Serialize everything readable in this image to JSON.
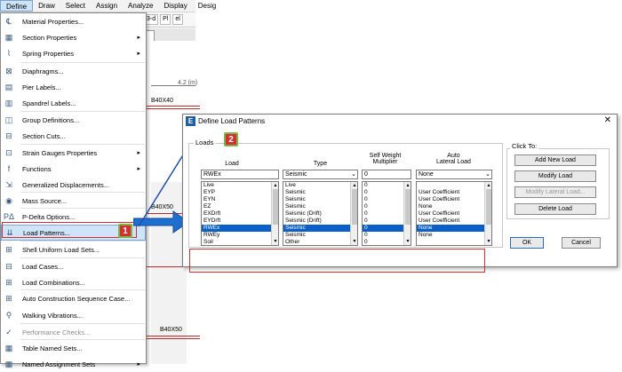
{
  "menubar": [
    "Define",
    "Draw",
    "Select",
    "Assign",
    "Analyze",
    "Display",
    "Desig"
  ],
  "toolbar": {
    "btn1": "3-d",
    "btn2": "Pl",
    "btn3": "el"
  },
  "canvas": {
    "dimension": "4.2 (m)",
    "beam1": "B40X40",
    "beam2": "B40X50",
    "beam3": "B40X50",
    "beam4": "B40X50"
  },
  "menu": [
    {
      "icon": "fx-icon",
      "label": "Material Properties...",
      "sub": false
    },
    {
      "icon": "section-icon",
      "label": "Section Properties",
      "sub": true
    },
    {
      "icon": "spring-icon",
      "label": "Spring Properties",
      "sub": true
    },
    {
      "icon": "diaphragm-icon",
      "label": "Diaphragms...",
      "sub": false
    },
    {
      "icon": "pier-icon",
      "label": "Pier Labels...",
      "sub": false
    },
    {
      "icon": "spandrel-icon",
      "label": "Spandrel Labels...",
      "sub": false
    },
    {
      "icon": "group-icon",
      "label": "Group Definitions...",
      "sub": false
    },
    {
      "icon": "section-cut-icon",
      "label": "Section Cuts...",
      "sub": false
    },
    {
      "icon": "strain-gauge-icon",
      "label": "Strain Gauges Properties",
      "sub": true
    },
    {
      "icon": "function-icon",
      "label": "Functions",
      "sub": true
    },
    {
      "icon": "displacement-icon",
      "label": "Generalized Displacements...",
      "sub": false
    },
    {
      "icon": "mass-icon",
      "label": "Mass Source...",
      "sub": false
    },
    {
      "icon": "pdelta-icon",
      "label": "P-Delta Options...",
      "sub": false
    },
    {
      "icon": "load-pattern-icon",
      "label": "Load Patterns...",
      "sub": false
    },
    {
      "icon": "shell-load-icon",
      "label": "Shell Uniform Load Sets...",
      "sub": false
    },
    {
      "icon": "load-case-icon",
      "label": "Load Cases...",
      "sub": false
    },
    {
      "icon": "load-combo-icon",
      "label": "Load Combinations...",
      "sub": false
    },
    {
      "icon": "construction-icon",
      "label": "Auto Construction Sequence Case...",
      "sub": false
    },
    {
      "icon": "walking-icon",
      "label": "Walking Vibrations...",
      "sub": false
    },
    {
      "icon": "performance-icon",
      "label": "Performance Checks...",
      "sub": false
    },
    {
      "icon": "table-icon",
      "label": "Table Named Sets...",
      "sub": false
    },
    {
      "icon": "named-assign-icon",
      "label": "Named Assignment Sets",
      "sub": true
    }
  ],
  "menu_icons": [
    "℄",
    "▦",
    "⌇",
    "⊠",
    "▤",
    "▥",
    "◫",
    "⊟",
    "⊡",
    "f",
    "⇲",
    "◉",
    "PΔ",
    "⇊",
    "⊞",
    "⊟",
    "⊞",
    "⊞",
    "⚲",
    "✓",
    "▦",
    "▦"
  ],
  "badges": {
    "b1": "1",
    "b2": "2"
  },
  "dialog": {
    "icon": "E",
    "title": "Define Load Patterns",
    "close": "✕",
    "group_loads": "Loads",
    "group_click": "Click To:",
    "headers": {
      "load": "Load",
      "type": "Type",
      "self_weight": "Self Weight\nMultiplier",
      "auto": "Auto\nLateral Load"
    },
    "inputs": {
      "load": "RWEx",
      "type": "Seismic",
      "self_weight": "0",
      "auto": "None"
    },
    "rows": [
      {
        "load": "Live",
        "type": "Live",
        "mult": "0",
        "auto": ""
      },
      {
        "load": "EYP",
        "type": "Seismic",
        "mult": "0",
        "auto": "User Coefficient"
      },
      {
        "load": "EYN",
        "type": "Seismic",
        "mult": "0",
        "auto": "User Coefficient"
      },
      {
        "load": "EZ",
        "type": "Seismic",
        "mult": "0",
        "auto": "None"
      },
      {
        "load": "EXDrft",
        "type": "Seismic (Drift)",
        "mult": "0",
        "auto": "User Coefficient"
      },
      {
        "load": "EYDrft",
        "type": "Seismic (Drift)",
        "mult": "0",
        "auto": "User Coefficient"
      },
      {
        "load": "RWEx",
        "type": "Seismic",
        "mult": "0",
        "auto": "None"
      },
      {
        "load": "RWEy",
        "type": "Seismic",
        "mult": "0",
        "auto": "None"
      },
      {
        "load": "Soil",
        "type": "Other",
        "mult": "0",
        "auto": ""
      }
    ],
    "selected_row": 6,
    "buttons": {
      "add": "Add New Load",
      "modify": "Modify Load",
      "modify_lateral": "Modify Lateral Load...",
      "delete": "Delete Load",
      "ok": "OK",
      "cancel": "Cancel"
    }
  }
}
